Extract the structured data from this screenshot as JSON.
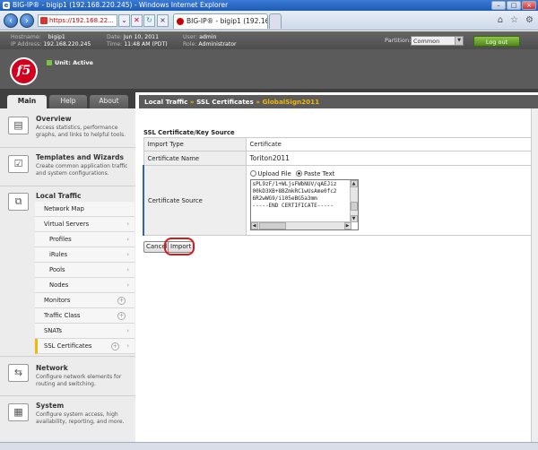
{
  "browser": {
    "title": "BIG-IP® - bigip1 (192.168.220.245) - Windows Internet Explorer",
    "address": "https://192.168.22...",
    "tab_label": "BIG-IP® - bigip1 (192.168.2..."
  },
  "header": {
    "hostname_label": "Hostname:",
    "hostname": "bigip1",
    "ip_label": "IP Address:",
    "ip": "192.168.220.245",
    "date_label": "Date:",
    "date": "Jun 10, 2011",
    "time_label": "Time:",
    "time": "11:48 AM (PDT)",
    "user_label": "User:",
    "user": "admin",
    "role_label": "Role:",
    "role": "Administrator",
    "partition_label": "Partition:",
    "partition_value": "Common",
    "logout": "Log out",
    "unit_status": "Unit: Active",
    "logo": "f5"
  },
  "tabs": [
    "Main",
    "Help",
    "About"
  ],
  "sidebar": {
    "overview_title": "Overview",
    "overview_desc": "Access statistics, performance graphs, and links to helpful tools.",
    "templates_title": "Templates and Wizards",
    "templates_desc": "Create common application traffic and system configurations.",
    "lt_title": "Local Traffic",
    "items": [
      "Network Map",
      "Virtual Servers",
      "Profiles",
      "iRules",
      "Pools",
      "Nodes",
      "Monitors",
      "Traffic Class",
      "SNATs",
      "SSL Certificates"
    ],
    "network_title": "Network",
    "network_desc": "Configure network elements for routing and switching.",
    "system_title": "System",
    "system_desc": "Configure system access, high availability, reporting, and more."
  },
  "breadcrumb": {
    "part1": "Local Traffic",
    "sep": "»",
    "part2": "SSL Certificates",
    "current": "GlobalSign2011"
  },
  "form": {
    "title": "SSL Certificate/Key Source",
    "import_type_label": "Import Type",
    "import_type_value": "Certificate",
    "cert_name_label": "Certificate Name",
    "cert_name_value": "Toriton2011",
    "cert_source_label": "Certificate Source",
    "upload_file": "Upload File",
    "paste_text": "Paste Text",
    "pasted_text": "sPL9zF/1+WLjsFWbNUV/qAEJiz\n00kD3XB+8BZmkRC1wUsAme0fc2\n6R2wWG9/i105eBG5a3mm\n-----END CERTIFICATE-----",
    "cancel": "Cancel",
    "import": "Import"
  },
  "colors": {
    "accent_yellow": "#f2b705",
    "logout_green": "#4f8a1e",
    "highlight_red": "#d7191c",
    "f5_red": "#d1001f"
  }
}
